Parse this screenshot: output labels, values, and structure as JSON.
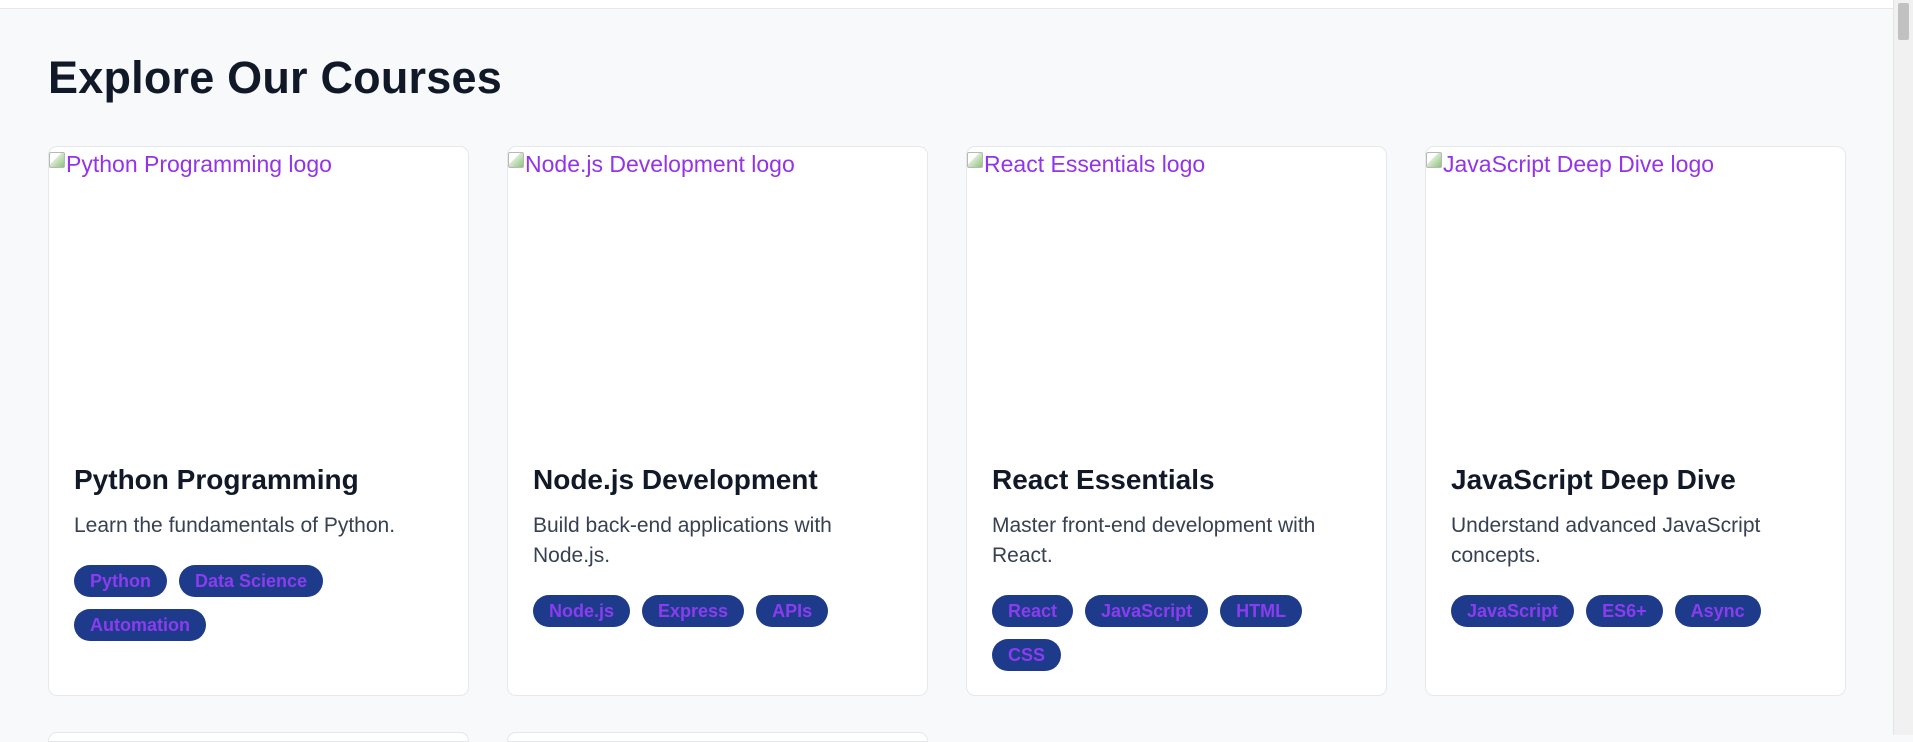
{
  "page": {
    "title": "Explore Our Courses"
  },
  "courses": [
    {
      "image_alt": "Python Programming logo",
      "title": "Python Programming",
      "description": "Learn the fundamentals of Python.",
      "tags": [
        "Python",
        "Data Science",
        "Automation"
      ]
    },
    {
      "image_alt": "Node.js Development logo",
      "title": "Node.js Development",
      "description": "Build back-end applications with Node.js.",
      "tags": [
        "Node.js",
        "Express",
        "APIs"
      ]
    },
    {
      "image_alt": "React Essentials logo",
      "title": "React Essentials",
      "description": "Master front-end development with React.",
      "tags": [
        "React",
        "JavaScript",
        "HTML",
        "CSS"
      ]
    },
    {
      "image_alt": "JavaScript Deep Dive logo",
      "title": "JavaScript Deep Dive",
      "description": "Understand advanced JavaScript concepts.",
      "tags": [
        "JavaScript",
        "ES6+",
        "Async"
      ]
    }
  ],
  "colors": {
    "page_background": "#f8f9fb",
    "title_text": "#111827",
    "alt_text": "#9333ea",
    "tag_background": "#1e3a8a",
    "tag_text": "#8b3cf0"
  }
}
